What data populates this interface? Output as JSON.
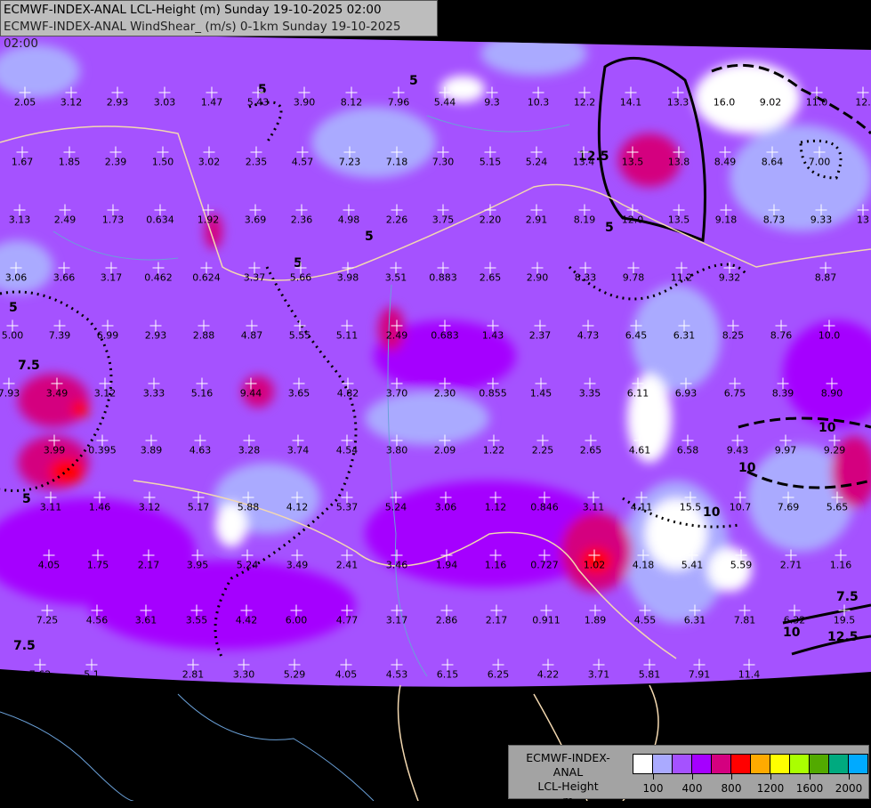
{
  "header": {
    "line1": "ECMWF-INDEX-ANAL LCL-Height (m) Sunday 19-10-2025 02:00",
    "line2": "ECMWF-INDEX-ANAL WindShear_ (m/s) 0-1km Sunday 19-10-2025 02:00"
  },
  "legend": {
    "model": "ECMWF-INDEX-ANAL",
    "variable": "LCL-Height",
    "unit": "m",
    "colors": [
      "#ffffff",
      "#aaaaff",
      "#a552ff",
      "#a500ff",
      "#d4007f",
      "#ff0000",
      "#ffaa00",
      "#ffff00",
      "#aaff00",
      "#52aa00",
      "#00aa7f",
      "#00aaff"
    ],
    "tick_labels": [
      "100",
      "400",
      "800",
      "1200",
      "1600",
      "2000"
    ]
  },
  "contour_labels": [
    "5",
    "5",
    "5",
    "7.5",
    "10",
    "10",
    "12.5",
    "5",
    "7.5",
    "5",
    "10",
    "7.5",
    "12.5",
    "5",
    "10",
    "5"
  ],
  "labels": [
    "2.05",
    "3.12",
    "2.93",
    "3.03",
    "1.47",
    "5.43",
    "3.90",
    "8.12",
    "7.96",
    "5.44",
    "9.3",
    "10.3",
    "12.2",
    "14.1",
    "13.3",
    "16.0",
    "9.02",
    "11.0",
    "12.",
    "1.67",
    "1.85",
    "2.39",
    "1.50",
    "3.02",
    "2.35",
    "4.57",
    "7.23",
    "7.18",
    "7.30",
    "5.15",
    "5.24",
    "13.4",
    "13.5",
    "13.8",
    "8.49",
    "8.64",
    "7.00",
    "3.13",
    "2.49",
    "1.73",
    "0.634",
    "1.92",
    "3.69",
    "2.36",
    "4.98",
    "2.26",
    "3.75",
    "2.20",
    "2.91",
    "8.19",
    "12.0",
    "13.5",
    "9.18",
    "8.73",
    "9.33",
    "13",
    "3.06",
    "3.66",
    "3.17",
    "0.462",
    "0.624",
    "3.37",
    "5.66",
    "3.98",
    "3.51",
    "0.883",
    "2.65",
    "2.90",
    "8.33",
    "9.78",
    "11.2",
    "9.32",
    "8.87",
    "5.00",
    "7.39",
    "6.99",
    "2.93",
    "2.88",
    "4.87",
    "5.55",
    "5.11",
    "2.49",
    "0.683",
    "1.43",
    "2.37",
    "4.73",
    "6.45",
    "6.31",
    "8.25",
    "8.76",
    "10.0",
    "7.93",
    "3.49",
    "3.12",
    "3.33",
    "5.16",
    "9.44",
    "3.65",
    "4.82",
    "3.70",
    "2.30",
    "0.855",
    "1.45",
    "3.35",
    "6.11",
    "6.93",
    "6.75",
    "8.39",
    "8.90",
    "3.99",
    "0.395",
    "3.89",
    "4.63",
    "3.28",
    "3.74",
    "4.54",
    "3.80",
    "2.09",
    "1.22",
    "2.25",
    "2.65",
    "4.61",
    "6.58",
    "9.43",
    "9.97",
    "9.29",
    "3.11",
    "1.46",
    "3.12",
    "5.17",
    "5.88",
    "4.12",
    "5.37",
    "5.24",
    "3.06",
    "1.12",
    "0.846",
    "3.11",
    "4.11",
    "15.5",
    "10.7",
    "7.69",
    "5.65",
    "4.05",
    "1.75",
    "2.17",
    "3.95",
    "5.24",
    "3.49",
    "2.41",
    "3.46",
    "1.94",
    "1.16",
    "0.727",
    "1.02",
    "4.18",
    "5.41",
    "5.59",
    "2.71",
    "1.16",
    "7.25",
    "4.56",
    "3.61",
    "3.55",
    "4.42",
    "6.00",
    "4.77",
    "3.17",
    "2.86",
    "2.17",
    "0.911",
    "1.89",
    "4.55",
    "6.31",
    "7.81",
    "6.32",
    "19.5",
    "7.62",
    "5.1",
    "2.81",
    "3.30",
    "5.29",
    "4.05",
    "4.53",
    "6.15",
    "6.25",
    "4.22",
    "3.71",
    "5.81",
    "7.91",
    "11.4"
  ]
}
